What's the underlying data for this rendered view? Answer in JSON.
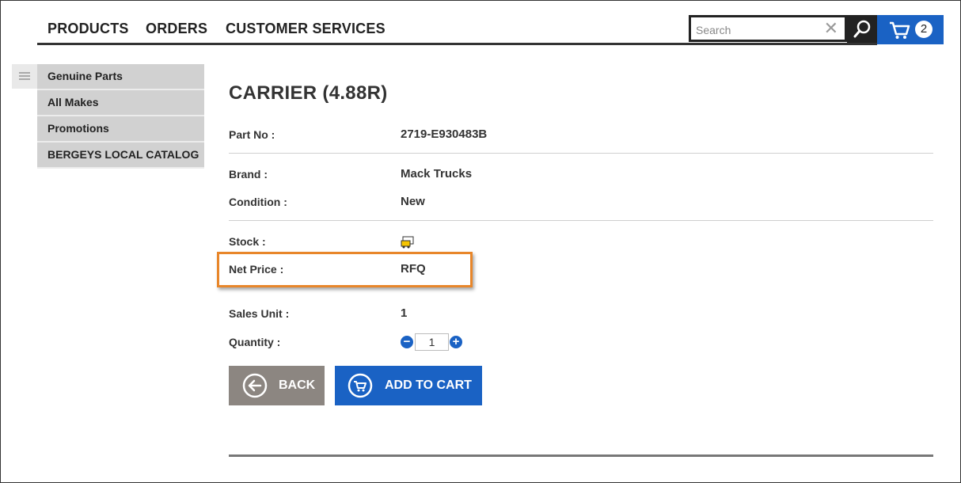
{
  "nav": {
    "items": [
      "PRODUCTS",
      "ORDERS",
      "CUSTOMER SERVICES"
    ]
  },
  "search": {
    "placeholder": "Search",
    "clear_icon": "close-icon",
    "search_icon": "search-icon"
  },
  "cart": {
    "count": "2",
    "icon": "cart-icon"
  },
  "sidebar": {
    "toggle_icon": "hamburger-icon",
    "items": [
      {
        "label": "Genuine Parts"
      },
      {
        "label": "All Makes"
      },
      {
        "label": "Promotions"
      },
      {
        "label": "BERGEYS LOCAL CATALOG"
      }
    ]
  },
  "product": {
    "title": "CARRIER (4.88R)",
    "part_no_label": "Part No :",
    "part_no": "2719-E930483B",
    "brand_label": "Brand :",
    "brand": "Mack Trucks",
    "condition_label": "Condition :",
    "condition": "New",
    "stock_label": "Stock :",
    "stock_icon": "stock-truck-icon",
    "net_price_label": "Net Price :",
    "net_price": "RFQ",
    "sales_unit_label": "Sales Unit :",
    "sales_unit": "1",
    "quantity_label": "Quantity :",
    "quantity": "1"
  },
  "actions": {
    "back_label": "BACK",
    "add_to_cart_label": "ADD TO CART"
  },
  "colors": {
    "accent_blue": "#1a62c4",
    "highlight_orange": "#e8862a",
    "back_gray": "#8c8681"
  }
}
